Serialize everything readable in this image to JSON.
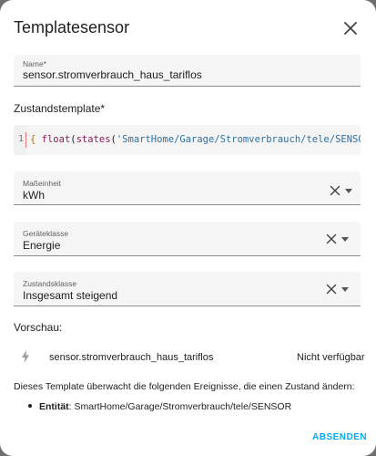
{
  "dialog": {
    "title": "Templatesensor",
    "close_icon": "close-icon"
  },
  "name_field": {
    "label": "Name*",
    "value": "sensor.stromverbrauch_haus_tariflos"
  },
  "state_template": {
    "label": "Zustandstemplate*",
    "line_number": "1",
    "code_open_brace": "{",
    "code_fn": "float",
    "code_paren_open": "(",
    "code_fn2": "states",
    "code_paren_open2": "(",
    "code_string": "'SmartHome/Garage/Stromverbrauch/tele/SENSOR'",
    "code_paren_close": ")"
  },
  "unit_field": {
    "label": "Maßeinheit",
    "value": "kWh"
  },
  "device_class_field": {
    "label": "Geräteklasse",
    "value": "Energie"
  },
  "state_class_field": {
    "label": "Zustandsklasse",
    "value": "Insgesamt steigend"
  },
  "preview": {
    "heading": "Vorschau:",
    "icon": "flash-icon",
    "entity": "sensor.stromverbrauch_haus_tariflos",
    "state": "Nicht verfügbar"
  },
  "listeners": {
    "intro": "Dieses Template überwacht die folgenden Ereignisse, die einen Zustand ändern:",
    "entity_label": "Entität",
    "entity_value": ": SmartHome/Garage/Stromverbrauch/tele/SENSOR"
  },
  "actions": {
    "submit_label": "ABSENDEN"
  },
  "colors": {
    "accent": "#03a9f4",
    "field_bg": "#f5f5f5",
    "overlay": "#6f6f6f"
  }
}
